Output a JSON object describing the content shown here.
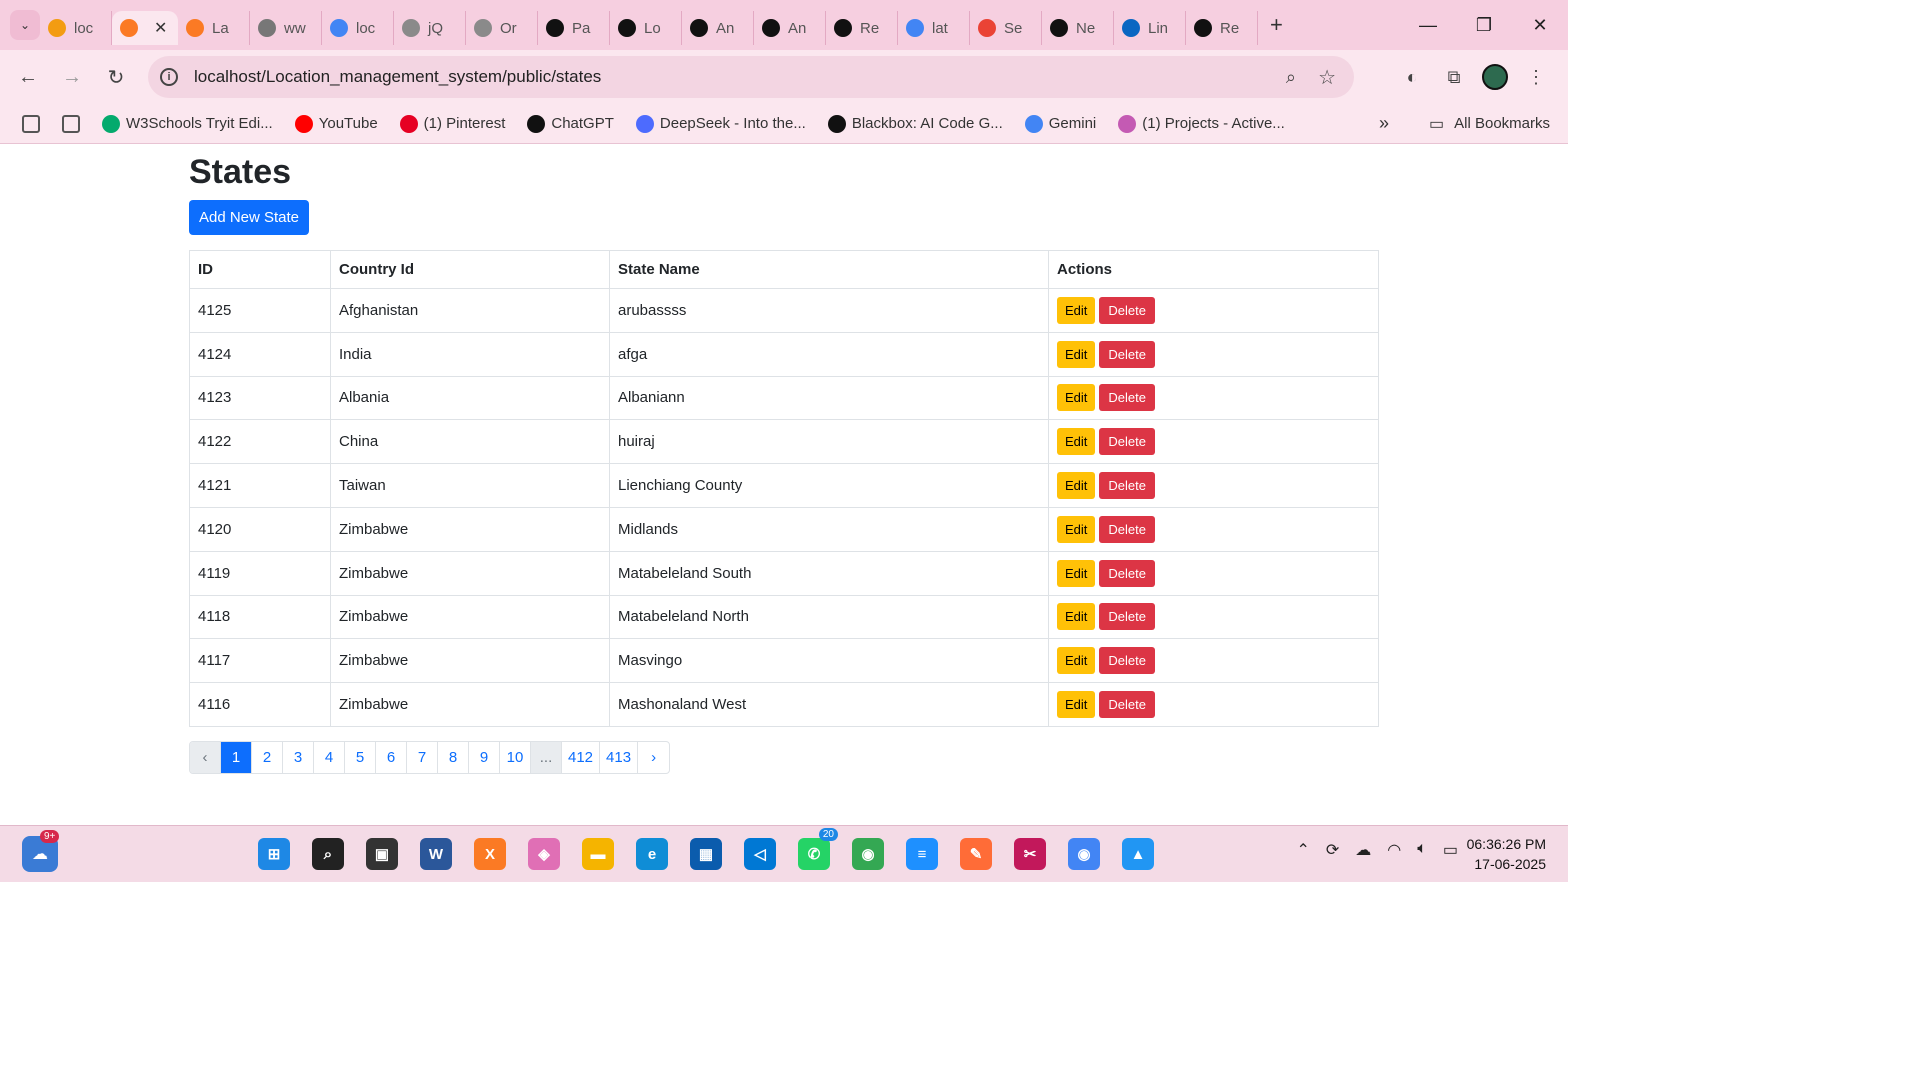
{
  "browser": {
    "tabs": [
      {
        "label": "loc",
        "icon": "phpmyadmin-icon",
        "color": "#f39c12"
      },
      {
        "label": "",
        "icon": "xampp-icon",
        "color": "#fb7a24",
        "active": true
      },
      {
        "label": "La",
        "icon": "xampp-icon",
        "color": "#fb7a24"
      },
      {
        "label": "ww",
        "icon": "globe-icon",
        "color": "#777777"
      },
      {
        "label": "loc",
        "icon": "google-icon",
        "color": "#4285f4"
      },
      {
        "label": "jQ",
        "icon": "owl-icon",
        "color": "#8a8a8a"
      },
      {
        "label": "Or",
        "icon": "owl-icon",
        "color": "#8a8a8a"
      },
      {
        "label": "Pa",
        "icon": "chatgpt-icon",
        "color": "#111111"
      },
      {
        "label": "Lo",
        "icon": "github-icon",
        "color": "#111111"
      },
      {
        "label": "An",
        "icon": "github-icon",
        "color": "#111111"
      },
      {
        "label": "An",
        "icon": "github-icon",
        "color": "#111111"
      },
      {
        "label": "Re",
        "icon": "github-icon",
        "color": "#111111"
      },
      {
        "label": "lat",
        "icon": "google-icon",
        "color": "#4285f4"
      },
      {
        "label": "Se",
        "icon": "gmail-icon",
        "color": "#ea4335"
      },
      {
        "label": "Ne",
        "icon": "chatgpt-icon",
        "color": "#111111"
      },
      {
        "label": "Lin",
        "icon": "linkedin-icon",
        "color": "#0a66c2"
      },
      {
        "label": "Re",
        "icon": "github-icon",
        "color": "#111111"
      }
    ],
    "url": "localhost/Location_management_system/public/states",
    "bookmarks": [
      {
        "label": "",
        "icon": "apps-grid-icon"
      },
      {
        "label": "",
        "icon": "a-logo-icon"
      },
      {
        "label": "W3Schools Tryit Edi...",
        "icon": "w3schools-icon",
        "color": "#04aa6d"
      },
      {
        "label": "YouTube",
        "icon": "youtube-icon",
        "color": "#ff0000"
      },
      {
        "label": "(1) Pinterest",
        "icon": "pinterest-icon",
        "color": "#e60023"
      },
      {
        "label": "ChatGPT",
        "icon": "chatgpt-icon",
        "color": "#111111"
      },
      {
        "label": "DeepSeek - Into the...",
        "icon": "deepseek-icon",
        "color": "#4d6bfe"
      },
      {
        "label": "Blackbox: AI Code G...",
        "icon": "blackbox-icon",
        "color": "#111111"
      },
      {
        "label": "Gemini",
        "icon": "gemini-icon",
        "color": "#4285f4"
      },
      {
        "label": "(1) Projects - Active...",
        "icon": "projects-icon",
        "color": "#c45ab3"
      }
    ],
    "all_bookmarks_label": "All Bookmarks"
  },
  "page": {
    "title": "States",
    "add_button": "Add New State",
    "columns": [
      "ID",
      "Country Id",
      "State Name",
      "Actions"
    ],
    "edit_label": "Edit",
    "delete_label": "Delete",
    "rows": [
      {
        "id": "4125",
        "country": "Afghanistan",
        "state": "arubassss"
      },
      {
        "id": "4124",
        "country": "India",
        "state": "afga"
      },
      {
        "id": "4123",
        "country": "Albania",
        "state": "Albaniann"
      },
      {
        "id": "4122",
        "country": "China",
        "state": "huiraj"
      },
      {
        "id": "4121",
        "country": "Taiwan",
        "state": "Lienchiang County"
      },
      {
        "id": "4120",
        "country": "Zimbabwe",
        "state": "Midlands"
      },
      {
        "id": "4119",
        "country": "Zimbabwe",
        "state": "Matabeleland South"
      },
      {
        "id": "4118",
        "country": "Zimbabwe",
        "state": "Matabeleland North"
      },
      {
        "id": "4117",
        "country": "Zimbabwe",
        "state": "Masvingo"
      },
      {
        "id": "4116",
        "country": "Zimbabwe",
        "state": "Mashonaland West"
      }
    ],
    "pagination": [
      {
        "label": "‹",
        "state": "disabled"
      },
      {
        "label": "1",
        "state": "active"
      },
      {
        "label": "2"
      },
      {
        "label": "3"
      },
      {
        "label": "4"
      },
      {
        "label": "5"
      },
      {
        "label": "6"
      },
      {
        "label": "7"
      },
      {
        "label": "8"
      },
      {
        "label": "9"
      },
      {
        "label": "10"
      },
      {
        "label": "...",
        "state": "disabled"
      },
      {
        "label": "412"
      },
      {
        "label": "413"
      },
      {
        "label": "›"
      }
    ]
  },
  "taskbar": {
    "notification_badge": "9+",
    "whatsapp_badge": "20",
    "apps": [
      {
        "icon": "windows-start-icon",
        "color": "#1e88e5"
      },
      {
        "icon": "search-icon",
        "color": "#222222"
      },
      {
        "icon": "task-view-icon",
        "color": "#333333"
      },
      {
        "icon": "word-icon",
        "color": "#2b579a"
      },
      {
        "icon": "xampp-icon",
        "color": "#fb7a24"
      },
      {
        "icon": "copilot-icon",
        "color": "#e06fb5"
      },
      {
        "icon": "file-explorer-icon",
        "color": "#f5b400"
      },
      {
        "icon": "edge-icon",
        "color": "#0f8dd6"
      },
      {
        "icon": "store-icon",
        "color": "#0b5cad"
      },
      {
        "icon": "vscode-icon",
        "color": "#0078d4"
      },
      {
        "icon": "whatsapp-icon",
        "color": "#25d366"
      },
      {
        "icon": "chrome-icon",
        "color": "#34a853"
      },
      {
        "icon": "notepad-icon",
        "color": "#1e90ff"
      },
      {
        "icon": "postman-icon",
        "color": "#ff6c37"
      },
      {
        "icon": "snipping-tool-icon",
        "color": "#c2185b"
      },
      {
        "icon": "chrome-profile-icon",
        "color": "#4285f4"
      },
      {
        "icon": "photos-icon",
        "color": "#2196f3"
      }
    ],
    "time": "06:36:26 PM",
    "date": "17-06-2025"
  }
}
